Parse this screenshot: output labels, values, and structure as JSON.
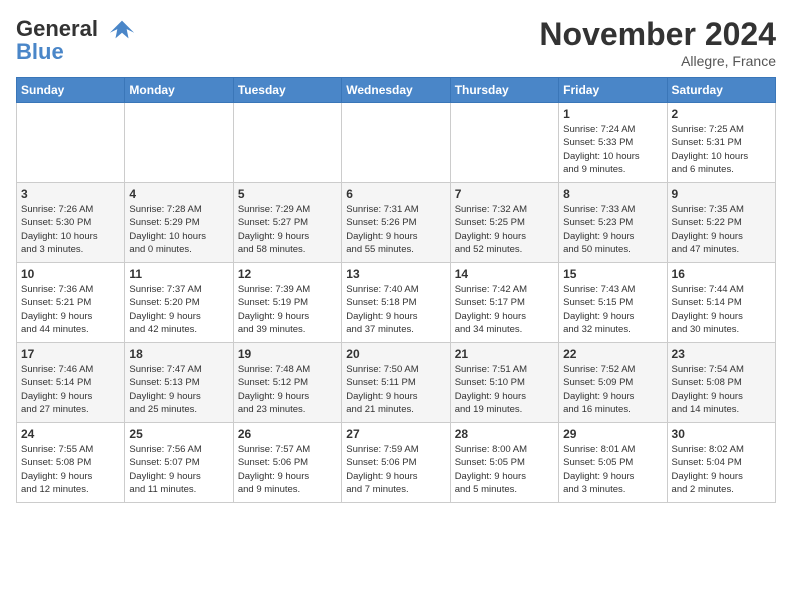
{
  "logo": {
    "line1": "General",
    "line2": "Blue"
  },
  "header": {
    "month": "November 2024",
    "location": "Allegre, France"
  },
  "weekdays": [
    "Sunday",
    "Monday",
    "Tuesday",
    "Wednesday",
    "Thursday",
    "Friday",
    "Saturday"
  ],
  "weeks": [
    [
      {
        "day": "",
        "info": ""
      },
      {
        "day": "",
        "info": ""
      },
      {
        "day": "",
        "info": ""
      },
      {
        "day": "",
        "info": ""
      },
      {
        "day": "",
        "info": ""
      },
      {
        "day": "1",
        "info": "Sunrise: 7:24 AM\nSunset: 5:33 PM\nDaylight: 10 hours\nand 9 minutes."
      },
      {
        "day": "2",
        "info": "Sunrise: 7:25 AM\nSunset: 5:31 PM\nDaylight: 10 hours\nand 6 minutes."
      }
    ],
    [
      {
        "day": "3",
        "info": "Sunrise: 7:26 AM\nSunset: 5:30 PM\nDaylight: 10 hours\nand 3 minutes."
      },
      {
        "day": "4",
        "info": "Sunrise: 7:28 AM\nSunset: 5:29 PM\nDaylight: 10 hours\nand 0 minutes."
      },
      {
        "day": "5",
        "info": "Sunrise: 7:29 AM\nSunset: 5:27 PM\nDaylight: 9 hours\nand 58 minutes."
      },
      {
        "day": "6",
        "info": "Sunrise: 7:31 AM\nSunset: 5:26 PM\nDaylight: 9 hours\nand 55 minutes."
      },
      {
        "day": "7",
        "info": "Sunrise: 7:32 AM\nSunset: 5:25 PM\nDaylight: 9 hours\nand 52 minutes."
      },
      {
        "day": "8",
        "info": "Sunrise: 7:33 AM\nSunset: 5:23 PM\nDaylight: 9 hours\nand 50 minutes."
      },
      {
        "day": "9",
        "info": "Sunrise: 7:35 AM\nSunset: 5:22 PM\nDaylight: 9 hours\nand 47 minutes."
      }
    ],
    [
      {
        "day": "10",
        "info": "Sunrise: 7:36 AM\nSunset: 5:21 PM\nDaylight: 9 hours\nand 44 minutes."
      },
      {
        "day": "11",
        "info": "Sunrise: 7:37 AM\nSunset: 5:20 PM\nDaylight: 9 hours\nand 42 minutes."
      },
      {
        "day": "12",
        "info": "Sunrise: 7:39 AM\nSunset: 5:19 PM\nDaylight: 9 hours\nand 39 minutes."
      },
      {
        "day": "13",
        "info": "Sunrise: 7:40 AM\nSunset: 5:18 PM\nDaylight: 9 hours\nand 37 minutes."
      },
      {
        "day": "14",
        "info": "Sunrise: 7:42 AM\nSunset: 5:17 PM\nDaylight: 9 hours\nand 34 minutes."
      },
      {
        "day": "15",
        "info": "Sunrise: 7:43 AM\nSunset: 5:15 PM\nDaylight: 9 hours\nand 32 minutes."
      },
      {
        "day": "16",
        "info": "Sunrise: 7:44 AM\nSunset: 5:14 PM\nDaylight: 9 hours\nand 30 minutes."
      }
    ],
    [
      {
        "day": "17",
        "info": "Sunrise: 7:46 AM\nSunset: 5:14 PM\nDaylight: 9 hours\nand 27 minutes."
      },
      {
        "day": "18",
        "info": "Sunrise: 7:47 AM\nSunset: 5:13 PM\nDaylight: 9 hours\nand 25 minutes."
      },
      {
        "day": "19",
        "info": "Sunrise: 7:48 AM\nSunset: 5:12 PM\nDaylight: 9 hours\nand 23 minutes."
      },
      {
        "day": "20",
        "info": "Sunrise: 7:50 AM\nSunset: 5:11 PM\nDaylight: 9 hours\nand 21 minutes."
      },
      {
        "day": "21",
        "info": "Sunrise: 7:51 AM\nSunset: 5:10 PM\nDaylight: 9 hours\nand 19 minutes."
      },
      {
        "day": "22",
        "info": "Sunrise: 7:52 AM\nSunset: 5:09 PM\nDaylight: 9 hours\nand 16 minutes."
      },
      {
        "day": "23",
        "info": "Sunrise: 7:54 AM\nSunset: 5:08 PM\nDaylight: 9 hours\nand 14 minutes."
      }
    ],
    [
      {
        "day": "24",
        "info": "Sunrise: 7:55 AM\nSunset: 5:08 PM\nDaylight: 9 hours\nand 12 minutes."
      },
      {
        "day": "25",
        "info": "Sunrise: 7:56 AM\nSunset: 5:07 PM\nDaylight: 9 hours\nand 11 minutes."
      },
      {
        "day": "26",
        "info": "Sunrise: 7:57 AM\nSunset: 5:06 PM\nDaylight: 9 hours\nand 9 minutes."
      },
      {
        "day": "27",
        "info": "Sunrise: 7:59 AM\nSunset: 5:06 PM\nDaylight: 9 hours\nand 7 minutes."
      },
      {
        "day": "28",
        "info": "Sunrise: 8:00 AM\nSunset: 5:05 PM\nDaylight: 9 hours\nand 5 minutes."
      },
      {
        "day": "29",
        "info": "Sunrise: 8:01 AM\nSunset: 5:05 PM\nDaylight: 9 hours\nand 3 minutes."
      },
      {
        "day": "30",
        "info": "Sunrise: 8:02 AM\nSunset: 5:04 PM\nDaylight: 9 hours\nand 2 minutes."
      }
    ]
  ]
}
